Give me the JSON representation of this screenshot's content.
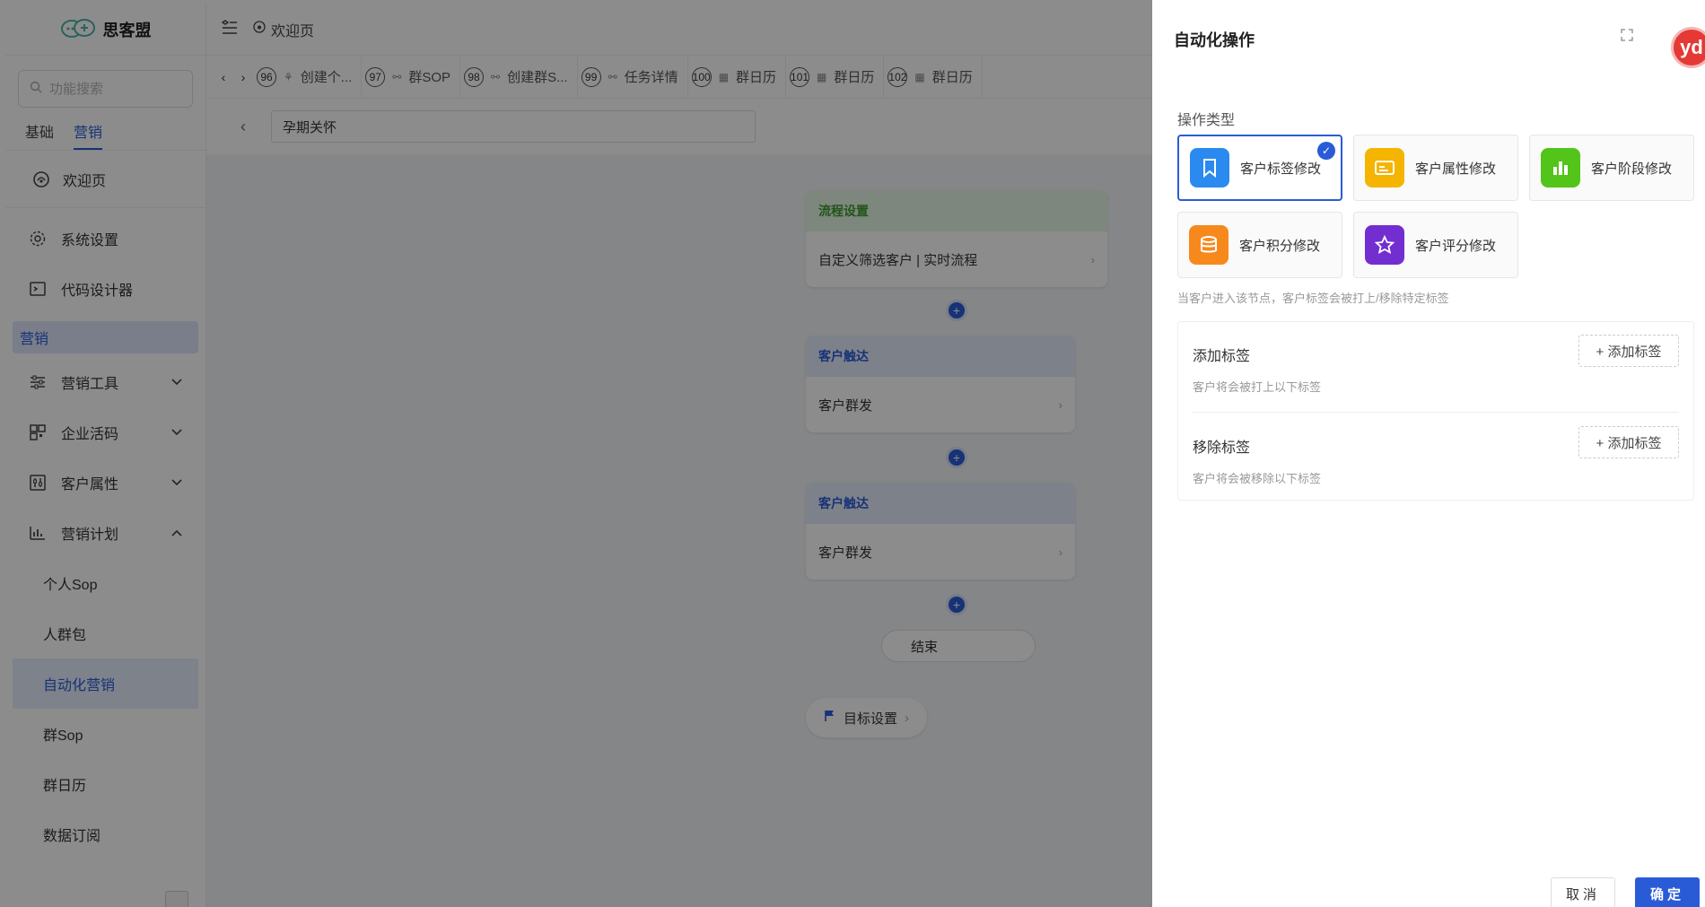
{
  "app": {
    "name": "思客盟"
  },
  "sidebar": {
    "search_placeholder": "功能搜索",
    "tabs": [
      {
        "label": "基础"
      },
      {
        "label": "营销"
      }
    ],
    "welcome": "欢迎页",
    "items": [
      {
        "label": "系统设置"
      },
      {
        "label": "代码设计器"
      }
    ],
    "group_label": "营销",
    "groups": [
      {
        "label": "营销工具",
        "chevron": "v"
      },
      {
        "label": "企业活码",
        "chevron": "v"
      },
      {
        "label": "客户属性",
        "chevron": "v"
      },
      {
        "label": "营销计划",
        "chevron": "^"
      }
    ],
    "sub_items": [
      {
        "label": "个人Sop"
      },
      {
        "label": "人群包"
      },
      {
        "label": "自动化营销"
      },
      {
        "label": "群Sop"
      },
      {
        "label": "群日历"
      },
      {
        "label": "数据订阅"
      }
    ]
  },
  "topbar": {
    "crumb": "欢迎页"
  },
  "tabstrip": {
    "tabs": [
      {
        "num": "96",
        "label": "创建个..."
      },
      {
        "num": "97",
        "label": "群SOP"
      },
      {
        "num": "98",
        "label": "创建群S..."
      },
      {
        "num": "99",
        "label": "任务详情"
      },
      {
        "num": "100",
        "label": "群日历"
      },
      {
        "num": "101",
        "label": "群日历"
      },
      {
        "num": "102",
        "label": "群日历"
      }
    ]
  },
  "subbar": {
    "title_value": "孕期关怀"
  },
  "flow": {
    "card1": {
      "head": "流程设置",
      "body": "自定义筛选客户 | 实时流程"
    },
    "card2": {
      "head": "客户触达",
      "body": "客户群发"
    },
    "card3": {
      "head": "客户触达",
      "body": "客户群发"
    },
    "end": "结束",
    "goal": "目标设置"
  },
  "drawer": {
    "title": "自动化操作",
    "avatar_text": "yd",
    "section_label": "操作类型",
    "ops": [
      {
        "label": "客户标签修改",
        "color": "#2a8af0",
        "icon": "bookmark-icon",
        "selected": true
      },
      {
        "label": "客户属性修改",
        "color": "#f5b400",
        "icon": "id-card-icon",
        "selected": false
      },
      {
        "label": "客户阶段修改",
        "color": "#52c41a",
        "icon": "bar-chart-icon",
        "selected": false
      },
      {
        "label": "客户积分修改",
        "color": "#f7891c",
        "icon": "coins-icon",
        "selected": false
      },
      {
        "label": "客户评分修改",
        "color": "#722ed1",
        "icon": "star-icon",
        "selected": false
      }
    ],
    "hint": "当客户进入该节点，客户标签会被打上/移除特定标签",
    "add_section": {
      "title": "添加标签",
      "desc": "客户将会被打上以下标签",
      "button": "+ 添加标签"
    },
    "remove_section": {
      "title": "移除标签",
      "desc": "客户将会被移除以下标签",
      "button": "+ 添加标签"
    },
    "cancel": "取消",
    "confirm": "确定"
  },
  "colors": {
    "primary": "#2a5bd7",
    "success": "#3f9b2f",
    "overlay": "rgba(0,0,0,0.45)"
  }
}
